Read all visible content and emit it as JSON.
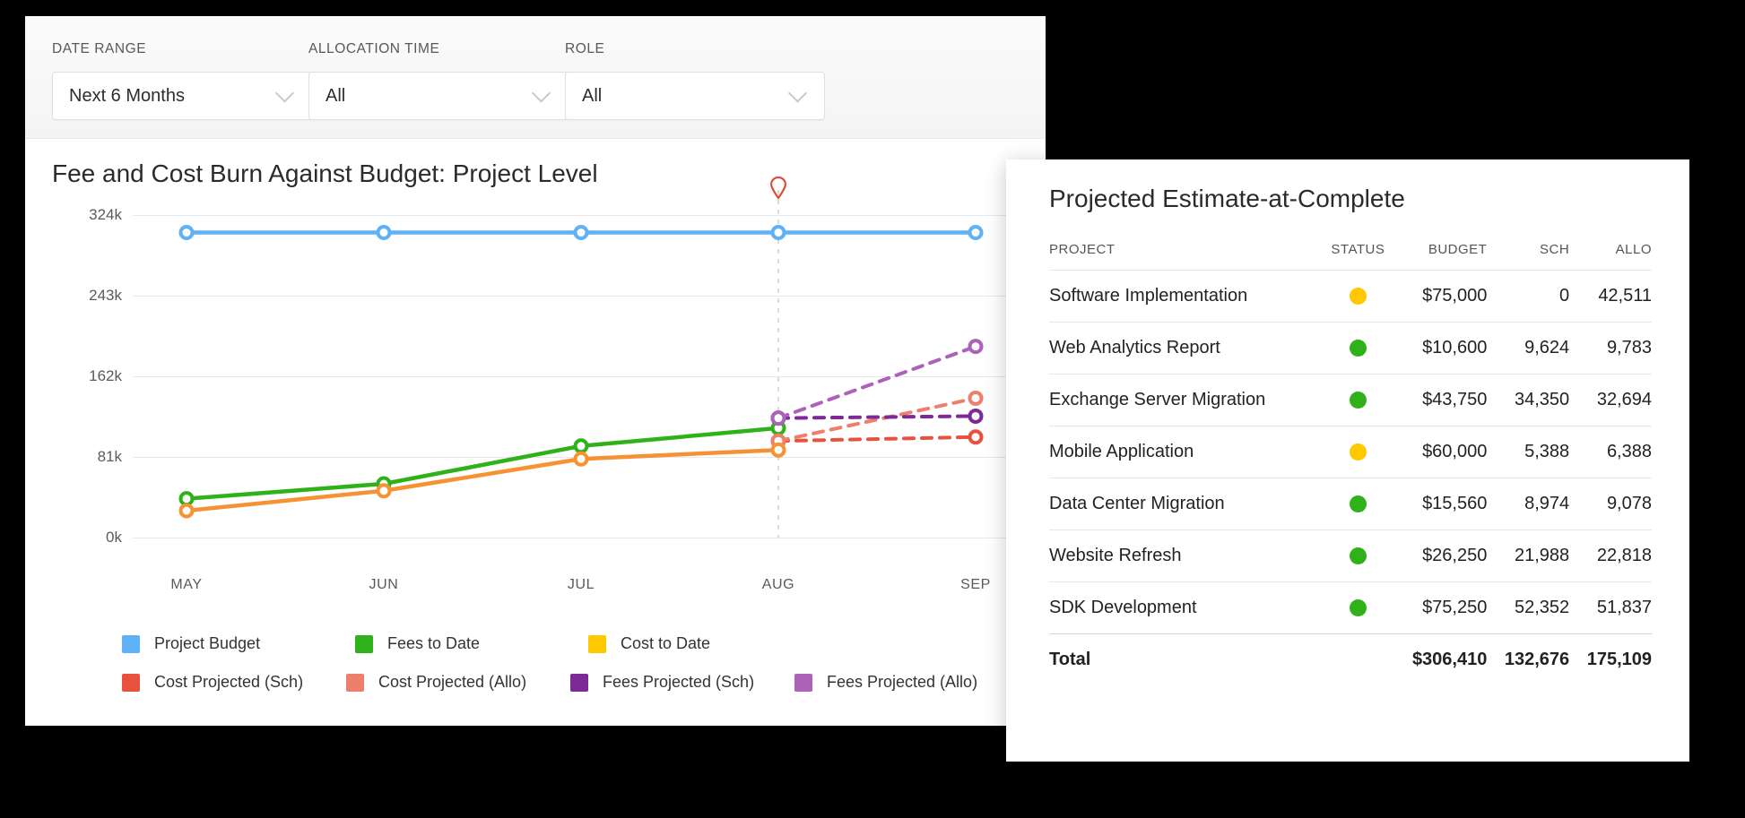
{
  "filters": [
    {
      "label": "DATE RANGE",
      "value": "Next 6 Months",
      "icon": "chevron-down-icon"
    },
    {
      "label": "ALLOCATION TIME",
      "value": "All",
      "icon": "chevron-down-icon"
    },
    {
      "label": "ROLE",
      "value": "All",
      "icon": "chevron-down-icon"
    }
  ],
  "chart_title": "Fee and Cost Burn Against Budget: Project Level",
  "today_marker_icon": "location-pin-icon",
  "panel": {
    "title": "Projected Estimate-at-Complete",
    "columns": [
      "PROJECT",
      "STATUS",
      "BUDGET",
      "SCH",
      "ALLO"
    ],
    "rows": [
      {
        "project": "Software Implementation",
        "status": "yellow",
        "budget": "$75,000",
        "sch": "0",
        "allo": "42,511"
      },
      {
        "project": "Web Analytics Report",
        "status": "green",
        "budget": "$10,600",
        "sch": "9,624",
        "allo": "9,783"
      },
      {
        "project": "Exchange Server Migration",
        "status": "green",
        "budget": "$43,750",
        "sch": "34,350",
        "allo": "32,694"
      },
      {
        "project": "Mobile Application",
        "status": "yellow",
        "budget": "$60,000",
        "sch": "5,388",
        "allo": "6,388"
      },
      {
        "project": "Data Center Migration",
        "status": "green",
        "budget": "$15,560",
        "sch": "8,974",
        "allo": "9,078"
      },
      {
        "project": "Website Refresh",
        "status": "green",
        "budget": "$26,250",
        "sch": "21,988",
        "allo": "22,818"
      },
      {
        "project": "SDK Development",
        "status": "green",
        "budget": "$75,250",
        "sch": "52,352",
        "allo": "51,837"
      }
    ],
    "total": {
      "project": "Total",
      "status": "",
      "budget": "$306,410",
      "sch": "132,676",
      "allo": "175,109"
    },
    "status_colors": {
      "green": "#2fb219",
      "yellow": "#ffc800"
    }
  },
  "chart_data": {
    "type": "line",
    "title": "Fee and Cost Burn Against Budget: Project Level",
    "xlabel": "",
    "ylabel": "",
    "categories": [
      "MAY",
      "JUN",
      "JUL",
      "AUG",
      "SEP"
    ],
    "ylim": [
      0,
      324000
    ],
    "yticks": [
      0,
      81000,
      162000,
      243000,
      324000
    ],
    "ytick_labels": [
      "0k",
      "81k",
      "162k",
      "243k",
      "324k"
    ],
    "grid": true,
    "legend_position": "bottom",
    "today_line_at": "AUG",
    "series": [
      {
        "name": "Project Budget",
        "color": "#5fb2f5",
        "style": "solid",
        "x": [
          "MAY",
          "JUN",
          "JUL",
          "AUG",
          "SEP"
        ],
        "values": [
          306410,
          306410,
          306410,
          306410,
          306410
        ]
      },
      {
        "name": "Fees to Date",
        "color": "#2fb219",
        "style": "solid",
        "x": [
          "MAY",
          "JUN",
          "JUL",
          "AUG"
        ],
        "values": [
          39000,
          54000,
          92000,
          110000
        ]
      },
      {
        "name": "Cost to Date",
        "color": "#ffc800",
        "style": "solid",
        "x": [],
        "values": []
      },
      {
        "name": "Cost Projected (Sch)",
        "color": "#e8513c",
        "style": "dashed",
        "x": [
          "AUG",
          "SEP"
        ],
        "values": [
          97000,
          101000
        ]
      },
      {
        "name": "Cost Projected (Allo)",
        "color": "#ef7f6d",
        "style": "dashed",
        "x": [
          "AUG",
          "SEP"
        ],
        "values": [
          97000,
          140000
        ]
      },
      {
        "name": "Fees Projected (Sch)",
        "color": "#7b2a96",
        "style": "dashed",
        "x": [
          "AUG",
          "SEP"
        ],
        "values": [
          120000,
          122000
        ]
      },
      {
        "name": "Fees Projected (Allo)",
        "color": "#ab62b8",
        "style": "dashed",
        "x": [
          "AUG",
          "SEP"
        ],
        "values": [
          120000,
          192000
        ]
      },
      {
        "name": "Cost to Date (actual)",
        "color": "#f79234",
        "style": "solid",
        "x": [
          "MAY",
          "JUN",
          "JUL",
          "AUG"
        ],
        "values": [
          27000,
          47000,
          79000,
          88000
        ]
      }
    ],
    "legend": [
      {
        "label": "Project Budget",
        "color": "#5fb2f5"
      },
      {
        "label": "Fees to Date",
        "color": "#2fb219"
      },
      {
        "label": "Cost to Date",
        "color": "#ffc800"
      },
      {
        "label": "Cost Projected (Sch)",
        "color": "#e8513c"
      },
      {
        "label": "Cost Projected (Allo)",
        "color": "#ef7f6d"
      },
      {
        "label": "Fees Projected (Sch)",
        "color": "#7b2a96"
      },
      {
        "label": "Fees Projected (Allo)",
        "color": "#ab62b8"
      }
    ]
  }
}
